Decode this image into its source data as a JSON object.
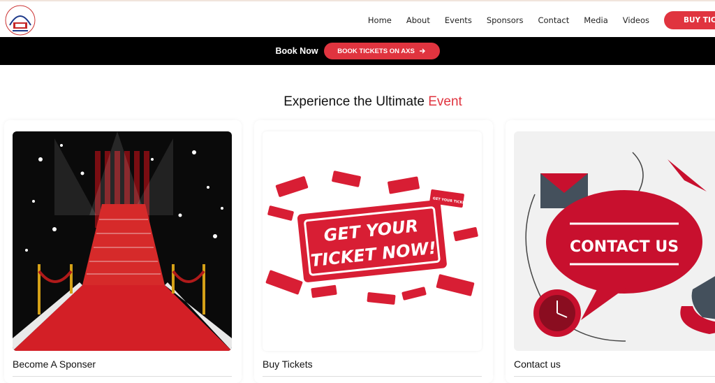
{
  "brand": {
    "logo_text": "TRIS ENTERTAINMENT GROUP"
  },
  "nav": {
    "items": [
      "Home",
      "About",
      "Events",
      "Sponsors",
      "Contact",
      "Media",
      "Videos"
    ],
    "buy_label": "BUY TICKETS"
  },
  "promo": {
    "label": "Book Now",
    "cta": "BOOK TICKETS ON AXS"
  },
  "section": {
    "title_a": "Experience the Ultimate",
    "title_b": "Event"
  },
  "cards": [
    {
      "caption": "Become A Sponser"
    },
    {
      "caption": "Buy Tickets",
      "art_text_1": "GET YOUR",
      "art_text_2": "TICKET NOW!",
      "mini_ticket_text": "GET YOUR TICKET NOW"
    },
    {
      "caption": "Contact us",
      "art_text": "CONTACT US"
    }
  ],
  "colors": {
    "accent": "#e0343f",
    "dark": "#000000"
  }
}
